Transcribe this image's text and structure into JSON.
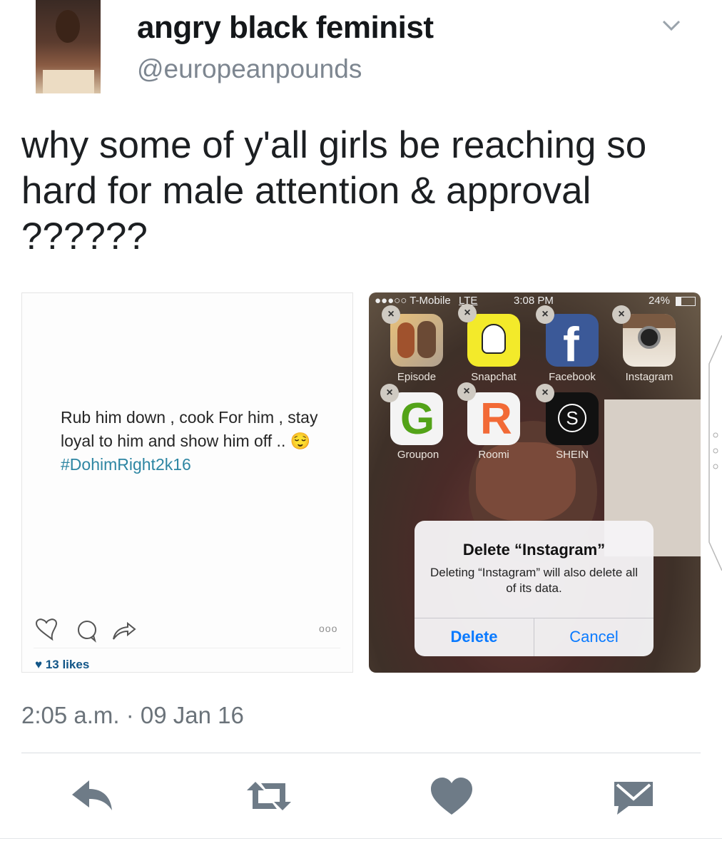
{
  "tweet": {
    "display_name": "angry black feminist",
    "handle": "@europeanpounds",
    "text": "why some of y'all girls be reaching so hard for male attention & approval ??????",
    "timestamp": "2:05 a.m. · 09 Jan 16"
  },
  "instagram_post": {
    "caption": "Rub him down , cook For him , stay loyal to him and show him off .. 😌",
    "hashtag": "#DohimRight2k16",
    "likes": "13 likes",
    "more_dots": "ooo",
    "accent_color": "#2e86a3"
  },
  "phone": {
    "carrier": "●●●○○ T-Mobile",
    "network": "LTE",
    "time": "3:08 PM",
    "battery": "24%",
    "apps": [
      {
        "label": "Episode",
        "icon": "episode-app-icon"
      },
      {
        "label": "Snapchat",
        "icon": "snapchat-ghost-icon"
      },
      {
        "label": "Facebook",
        "icon": "facebook-f-icon"
      },
      {
        "label": "Instagram",
        "icon": "instagram-camera-icon"
      },
      {
        "label": "Groupon",
        "icon": "groupon-g-icon"
      },
      {
        "label": "Roomi",
        "icon": "roomi-r-icon"
      },
      {
        "label": "SHEIN",
        "icon": "shein-s-icon"
      }
    ],
    "delete_badge": "×",
    "alert": {
      "title": "Delete “Instagram”",
      "message": "Deleting “Instagram” will also delete all of its data.",
      "delete_label": "Delete",
      "cancel_label": "Cancel",
      "button_color": "#0a7aff"
    }
  },
  "actions": {
    "reply": "reply-icon",
    "retweet": "retweet-icon",
    "like": "heart-icon",
    "message": "envelope-icon",
    "icon_color": "#6e7b87"
  }
}
